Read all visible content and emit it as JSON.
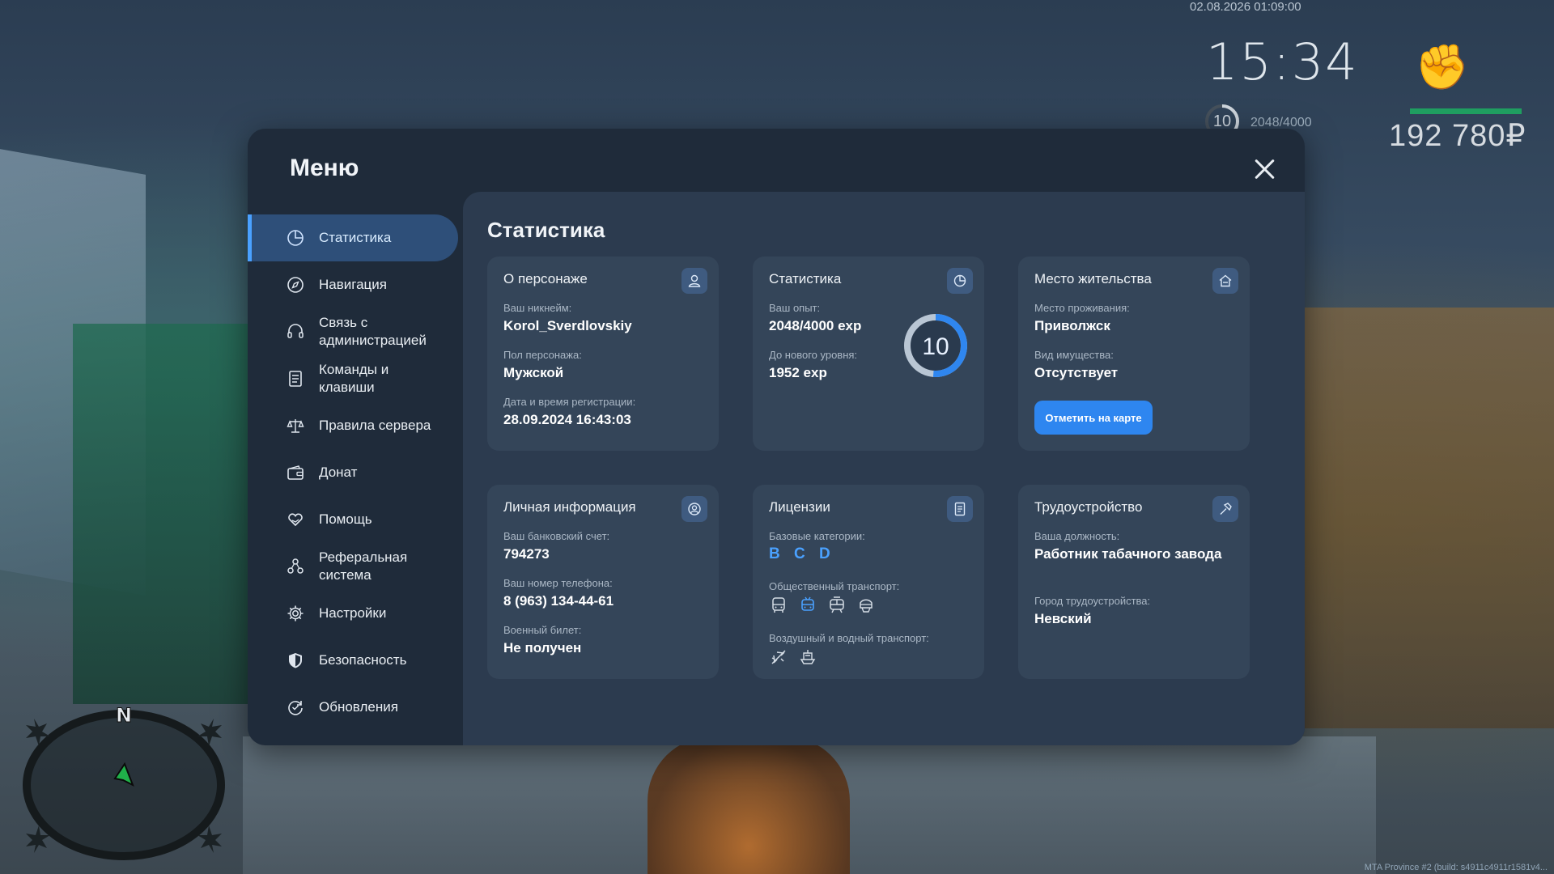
{
  "hud": {
    "datetime": "02.08.2026 01:09:00",
    "time": "15:34",
    "level": "10",
    "exp": "2048/4000",
    "money": "192 780₽",
    "footer": "MTA Province #2 (build: s4911c4911r1581v4..."
  },
  "compass": {
    "north": "N"
  },
  "menu": {
    "title": "Меню",
    "nav": [
      {
        "label": "Статистика",
        "icon": "pie-chart-icon",
        "active": true
      },
      {
        "label": "Навигация",
        "icon": "compass-icon"
      },
      {
        "label": "Связь с\nадминистрацией",
        "icon": "headset-icon"
      },
      {
        "label": "Команды и\nклавиши",
        "icon": "document-icon"
      },
      {
        "label": "Правила сервера",
        "icon": "scales-icon"
      },
      {
        "label": "Донат",
        "icon": "wallet-icon"
      },
      {
        "label": "Помощь",
        "icon": "heart-hands-icon"
      },
      {
        "label": "Реферальная\nсистема",
        "icon": "referral-icon"
      },
      {
        "label": "Настройки",
        "icon": "gear-icon"
      },
      {
        "label": "Безопасность",
        "icon": "shield-icon"
      },
      {
        "label": "Обновления",
        "icon": "refresh-icon"
      }
    ]
  },
  "content": {
    "title": "Статистика",
    "about": {
      "title": "О персонаже",
      "nick_label": "Ваш никнейм:",
      "nick": "Korol_Sverdlovskiy",
      "gender_label": "Пол персонажа:",
      "gender": "Мужской",
      "reg_label": "Дата и время регистрации:",
      "reg": "28.09.2024 16:43:03"
    },
    "stats": {
      "title": "Статистика",
      "exp_label": "Ваш опыт:",
      "exp": "2048/4000 exp",
      "next_label": "До нового уровня:",
      "next": "1952 exp",
      "level": "10",
      "progress": 0.512
    },
    "residence": {
      "title": "Место жительства",
      "place_label": "Место проживания:",
      "place": "Приволжск",
      "prop_label": "Вид имущества:",
      "prop": "Отсутствует",
      "button": "Отметить на карте"
    },
    "personal": {
      "title": "Личная информация",
      "bank_label": "Ваш банковский счет:",
      "bank": "794273",
      "phone_label": "Ваш номер телефона:",
      "phone": "8 (963) 134-44-61",
      "military_label": "Военный билет:",
      "military": "Не получен"
    },
    "licenses": {
      "title": "Лицензии",
      "base_label": "Базовые категории:",
      "base": "B C D",
      "public_label": "Общественный транспорт:",
      "air_label": "Воздушный и водный транспорт:"
    },
    "job": {
      "title": "Трудоустройство",
      "position_label": "Ваша должность:",
      "position": "Работник табачного завода",
      "city_label": "Город трудоустройства:",
      "city": "Невский"
    }
  },
  "colors": {
    "accent": "#2e86f0",
    "active_nav": "#2e4f79",
    "panel": "#1f2b3a",
    "card": "#344559"
  }
}
